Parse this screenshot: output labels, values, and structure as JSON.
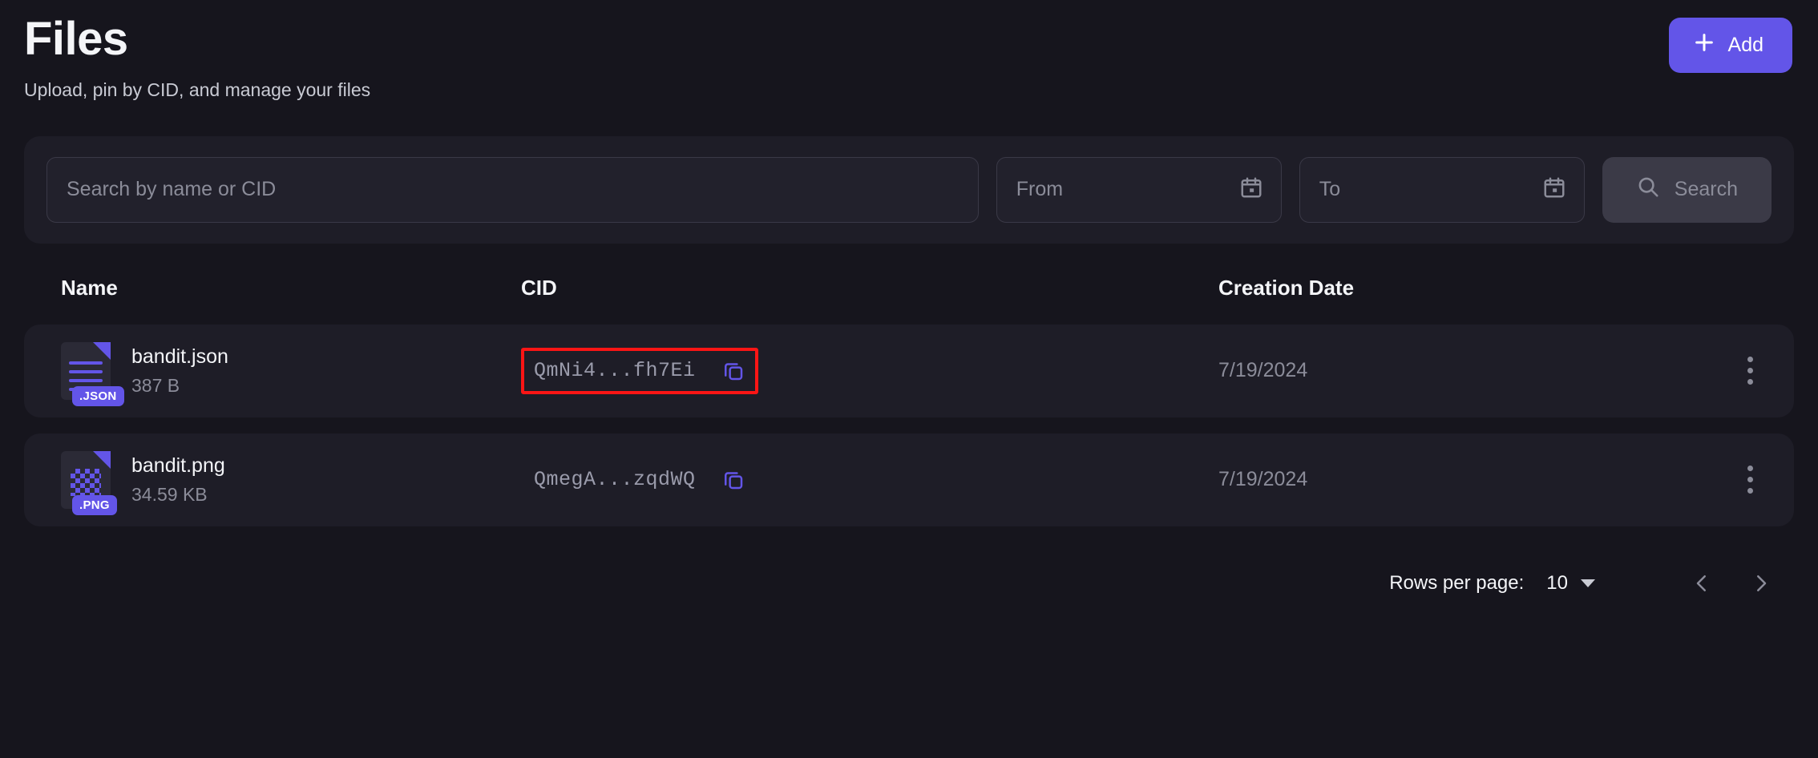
{
  "header": {
    "title": "Files",
    "subtitle": "Upload, pin by CID, and manage your files",
    "add_label": "Add",
    "add_icon": "plus-icon",
    "accent_color": "#6355e8"
  },
  "filters": {
    "search_placeholder": "Search by name or CID",
    "search_value": "",
    "from_placeholder": "From",
    "from_value": "",
    "to_placeholder": "To",
    "to_value": "",
    "calendar_icon": "calendar-icon",
    "search_button_label": "Search",
    "search_button_icon": "search-icon"
  },
  "table": {
    "columns": [
      "Name",
      "CID",
      "Creation Date"
    ],
    "rows": [
      {
        "name": "bandit.json",
        "size": "387 B",
        "ext_badge": ".JSON",
        "icon": "json-file-icon",
        "cid": "QmNi4...fh7Ei",
        "copy_icon": "copy-icon",
        "date": "7/19/2024",
        "menu_icon": "kebab-menu-icon",
        "highlighted": true
      },
      {
        "name": "bandit.png",
        "size": "34.59 KB",
        "ext_badge": ".PNG",
        "icon": "png-file-icon",
        "cid": "QmegA...zqdWQ",
        "copy_icon": "copy-icon",
        "date": "7/19/2024",
        "menu_icon": "kebab-menu-icon",
        "highlighted": false
      }
    ]
  },
  "pagination": {
    "rows_per_page_label": "Rows per page:",
    "rows_per_page_value": "10",
    "prev_icon": "chevron-left-icon",
    "next_icon": "chevron-right-icon"
  },
  "annotation": {
    "highlight_color": "#fb1515",
    "target": "cid-cell-row-1"
  }
}
